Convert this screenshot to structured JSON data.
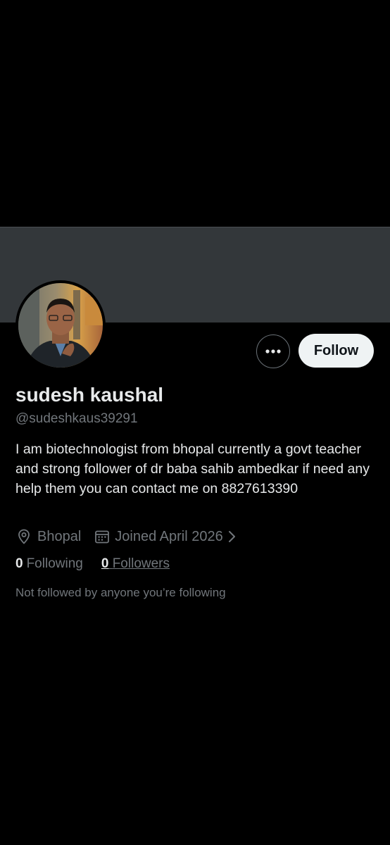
{
  "profile": {
    "name": "sudesh kaushal",
    "handle": "@sudeshkaus39291",
    "bio": "I am biotechnologist from bhopal currently a govt teacher and strong follower of dr baba sahib ambedkar if need any help them you can contact me on 8827613390",
    "location": "Bhopal",
    "joined": "Joined April 2026",
    "following_count": "0",
    "following_label": "Following",
    "followers_count": "0",
    "followers_label": "Followers",
    "mutuals_note": "Not followed by anyone you’re following"
  },
  "actions": {
    "follow_label": "Follow",
    "more_icon": "more-horizontal-icon"
  },
  "icons": {
    "location": "location-pin-icon",
    "calendar": "calendar-icon",
    "chevron": "chevron-right-icon"
  },
  "colors": {
    "background": "#000000",
    "banner": "#33373a",
    "primary_text": "#e7e9ea",
    "secondary_text": "#71767b",
    "follow_button_bg": "#eff3f4",
    "follow_button_text": "#0f1419"
  }
}
